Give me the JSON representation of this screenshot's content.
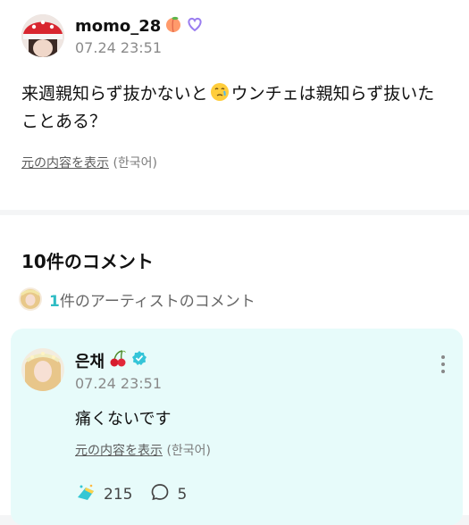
{
  "post": {
    "username": "momo_28",
    "timestamp": "07.24 23:51",
    "body_before": "来週親知らず抜かないと",
    "body_after": "ウンチェは親知らず抜いたことある？",
    "translate_link": "元の内容を表示",
    "translate_lang": "(한국어)"
  },
  "comments": {
    "title": "10件のコメント",
    "artist_count": "1",
    "artist_label": "件のアーティストのコメント",
    "items": [
      {
        "author": "은채",
        "timestamp": "07.24 23:51",
        "text": "痛くないです",
        "translate_link": "元の内容を表示",
        "translate_lang": "(한국어)",
        "likes": "215",
        "replies": "5"
      }
    ]
  },
  "colors": {
    "accent": "#2fbcc4",
    "card_bg": "#e7fbfa",
    "verified": "#34c5d8"
  },
  "icons": {
    "peach": "peach-icon",
    "heart": "purple-heart-icon",
    "cherry": "cherry-icon",
    "verified": "verified-badge-icon",
    "like": "like-icon",
    "comment": "comment-bubble-icon",
    "more": "more-vertical-icon"
  }
}
